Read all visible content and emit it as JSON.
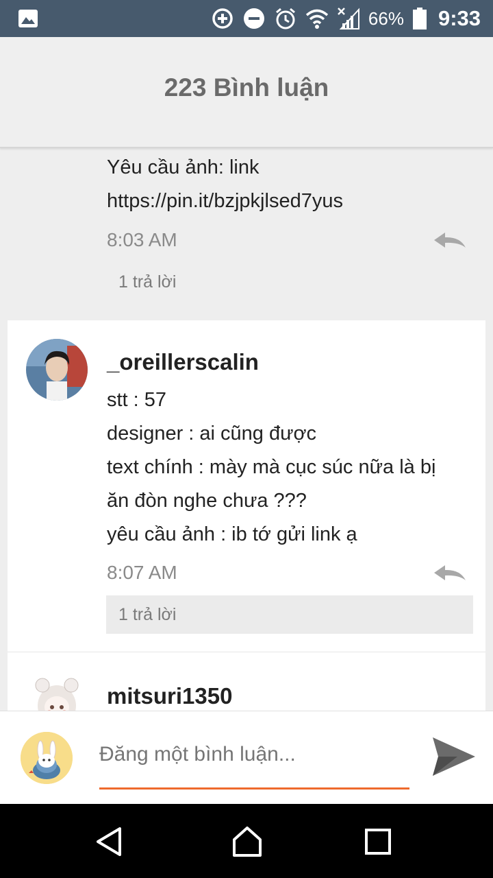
{
  "status_bar": {
    "battery": "66%",
    "time": "9:33",
    "icons": [
      "image-icon",
      "data-saver-icon",
      "do-not-disturb-icon",
      "alarm-icon",
      "wifi-icon",
      "no-signal-icon",
      "battery-icon"
    ]
  },
  "header": {
    "title": "223 Bình luận"
  },
  "previous_comment": {
    "lines": [
      "Yêu cầu ảnh: link",
      "https://pin.it/bzjpkjlsed7yus"
    ],
    "time": "8:03 AM",
    "replies": "1 trả lời"
  },
  "comment1": {
    "username": "_oreillerscalin",
    "lines": [
      "stt : 57",
      "designer : ai cũng được",
      "text chính : mày mà cục súc nữa là bị",
      "ăn đòn nghe chưa ???",
      "yêu cầu ảnh : ib tớ gửi link ạ"
    ],
    "time": "8:07 AM",
    "replies": "1 trả lời"
  },
  "comment2": {
    "username": "mitsuri1350"
  },
  "composer": {
    "placeholder": "Đăng một bình luận..."
  },
  "colors": {
    "status_bar": "#475a6d",
    "accent": "#ee6a2c",
    "nav_bar": "#000000"
  }
}
